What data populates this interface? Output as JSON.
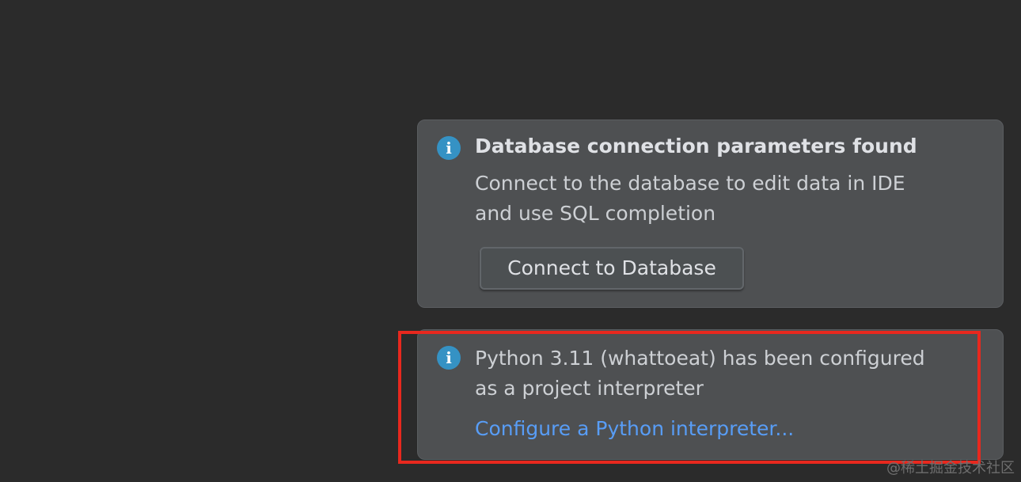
{
  "notifications": [
    {
      "icon": "info-icon",
      "title": "Database connection parameters found",
      "body_lines": [
        "Connect to the database to edit data in IDE",
        "and use SQL completion"
      ],
      "action_button_label": "Connect to Database"
    },
    {
      "icon": "info-icon",
      "body_lines": [
        "Python 3.11 (whattoeat) has been configured",
        "as a project interpreter"
      ],
      "action_link_label": "Configure a Python interpreter..."
    }
  ],
  "watermark": "@稀土掘金技术社区",
  "colors": {
    "background": "#2b2b2b",
    "notification_bg": "#4e5052",
    "info_icon": "#3592c4",
    "link": "#589df6",
    "highlight_border": "#e8281e"
  },
  "icons": {
    "info": "i"
  }
}
